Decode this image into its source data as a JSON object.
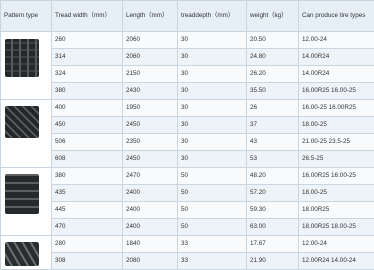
{
  "table": {
    "headers": [
      "Pattern type",
      "Tread width（mm）",
      "Length（mm）",
      "treaddepth（mm）",
      "weight（kg）",
      "Can produce tire types"
    ],
    "groups": [
      {
        "tread_pattern_icon": "tread-pattern-1-icon",
        "rows": [
          [
            "260",
            "2060",
            "30",
            "20.50",
            "12.00-24"
          ],
          [
            "314",
            "2060",
            "30",
            "24.80",
            "14.00R24"
          ],
          [
            "324",
            "2150",
            "30",
            "26.20",
            "14.00R24"
          ],
          [
            "380",
            "2430",
            "30",
            "35.50",
            "16.00R25  16.00-25"
          ]
        ]
      },
      {
        "tread_pattern_icon": "tread-pattern-2-icon",
        "rows": [
          [
            "400",
            "1950",
            "30",
            "26",
            "16.00-25  16.00R25"
          ],
          [
            "450",
            "2450",
            "30",
            "37",
            "18.00-25"
          ],
          [
            "506",
            "2350",
            "30",
            "43",
            "21.00-25  23.5-25"
          ],
          [
            "608",
            "2450",
            "30",
            "53",
            "26.5-25"
          ]
        ]
      },
      {
        "tread_pattern_icon": "tread-pattern-3-icon",
        "rows": [
          [
            "380",
            "2470",
            "50",
            "48.20",
            "16.00R25  16.00-25"
          ],
          [
            "435",
            "2400",
            "50",
            "57.20",
            "18.00-25"
          ],
          [
            "445",
            "2400",
            "50",
            "59.30",
            "18.00R25"
          ],
          [
            "470",
            "2400",
            "50",
            "63.00",
            "18.00R25  18.00-25"
          ]
        ]
      },
      {
        "tread_pattern_icon": "tread-pattern-4-icon",
        "rows": [
          [
            "280",
            "1840",
            "33",
            "17.67",
            "12.00-24"
          ],
          [
            "308",
            "2080",
            "33",
            "21.90",
            "12.00R24  14.00-24"
          ]
        ]
      }
    ]
  }
}
